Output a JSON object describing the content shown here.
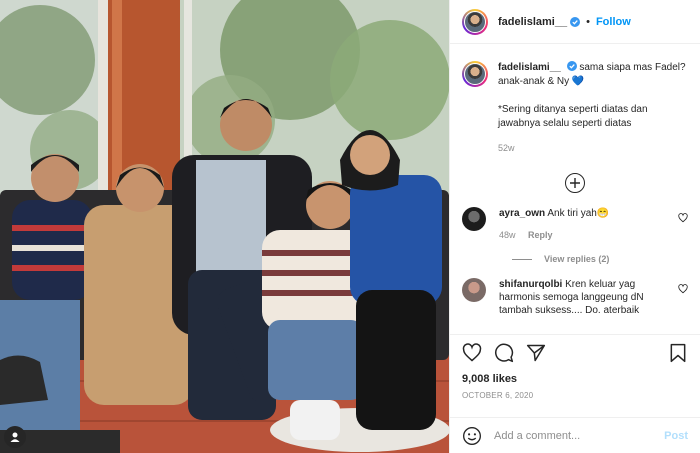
{
  "post": {
    "username": "fadelislami__",
    "follow_label": "Follow",
    "separator": "•",
    "caption_text": "sama siapa mas Fadel? anak-anak & Ny 💙",
    "caption_note": "*Sering ditanya seperti diatas dan jawabnya selalu seperti diatas",
    "caption_time": "52w",
    "likes": "9,008 likes",
    "date": "OCTOBER 6, 2020"
  },
  "comments": [
    {
      "username": "ayra_own",
      "text": "Ank tiri yah😁",
      "time": "48w",
      "reply_label": "Reply",
      "view_replies": "View replies (2)"
    },
    {
      "username": "shifanurqolbi",
      "text": "Kren keluar yag harmonis semoga langgeung dN tambah suksess.... Do. aterbaik"
    }
  ],
  "composer": {
    "placeholder": "Add a comment...",
    "post_label": "Post"
  },
  "icons": {
    "verified": "verified-badge-icon",
    "load_more": "plus-circle-icon",
    "like": "heart-icon",
    "comment": "comment-icon",
    "share": "paper-plane-icon",
    "save": "bookmark-icon",
    "emoji": "smiley-icon",
    "tags": "user-tag-icon"
  },
  "colors": {
    "accent": "#0095f6",
    "post_disabled": "#b2dffc",
    "muted": "#8e8e8e",
    "text": "#262626"
  }
}
